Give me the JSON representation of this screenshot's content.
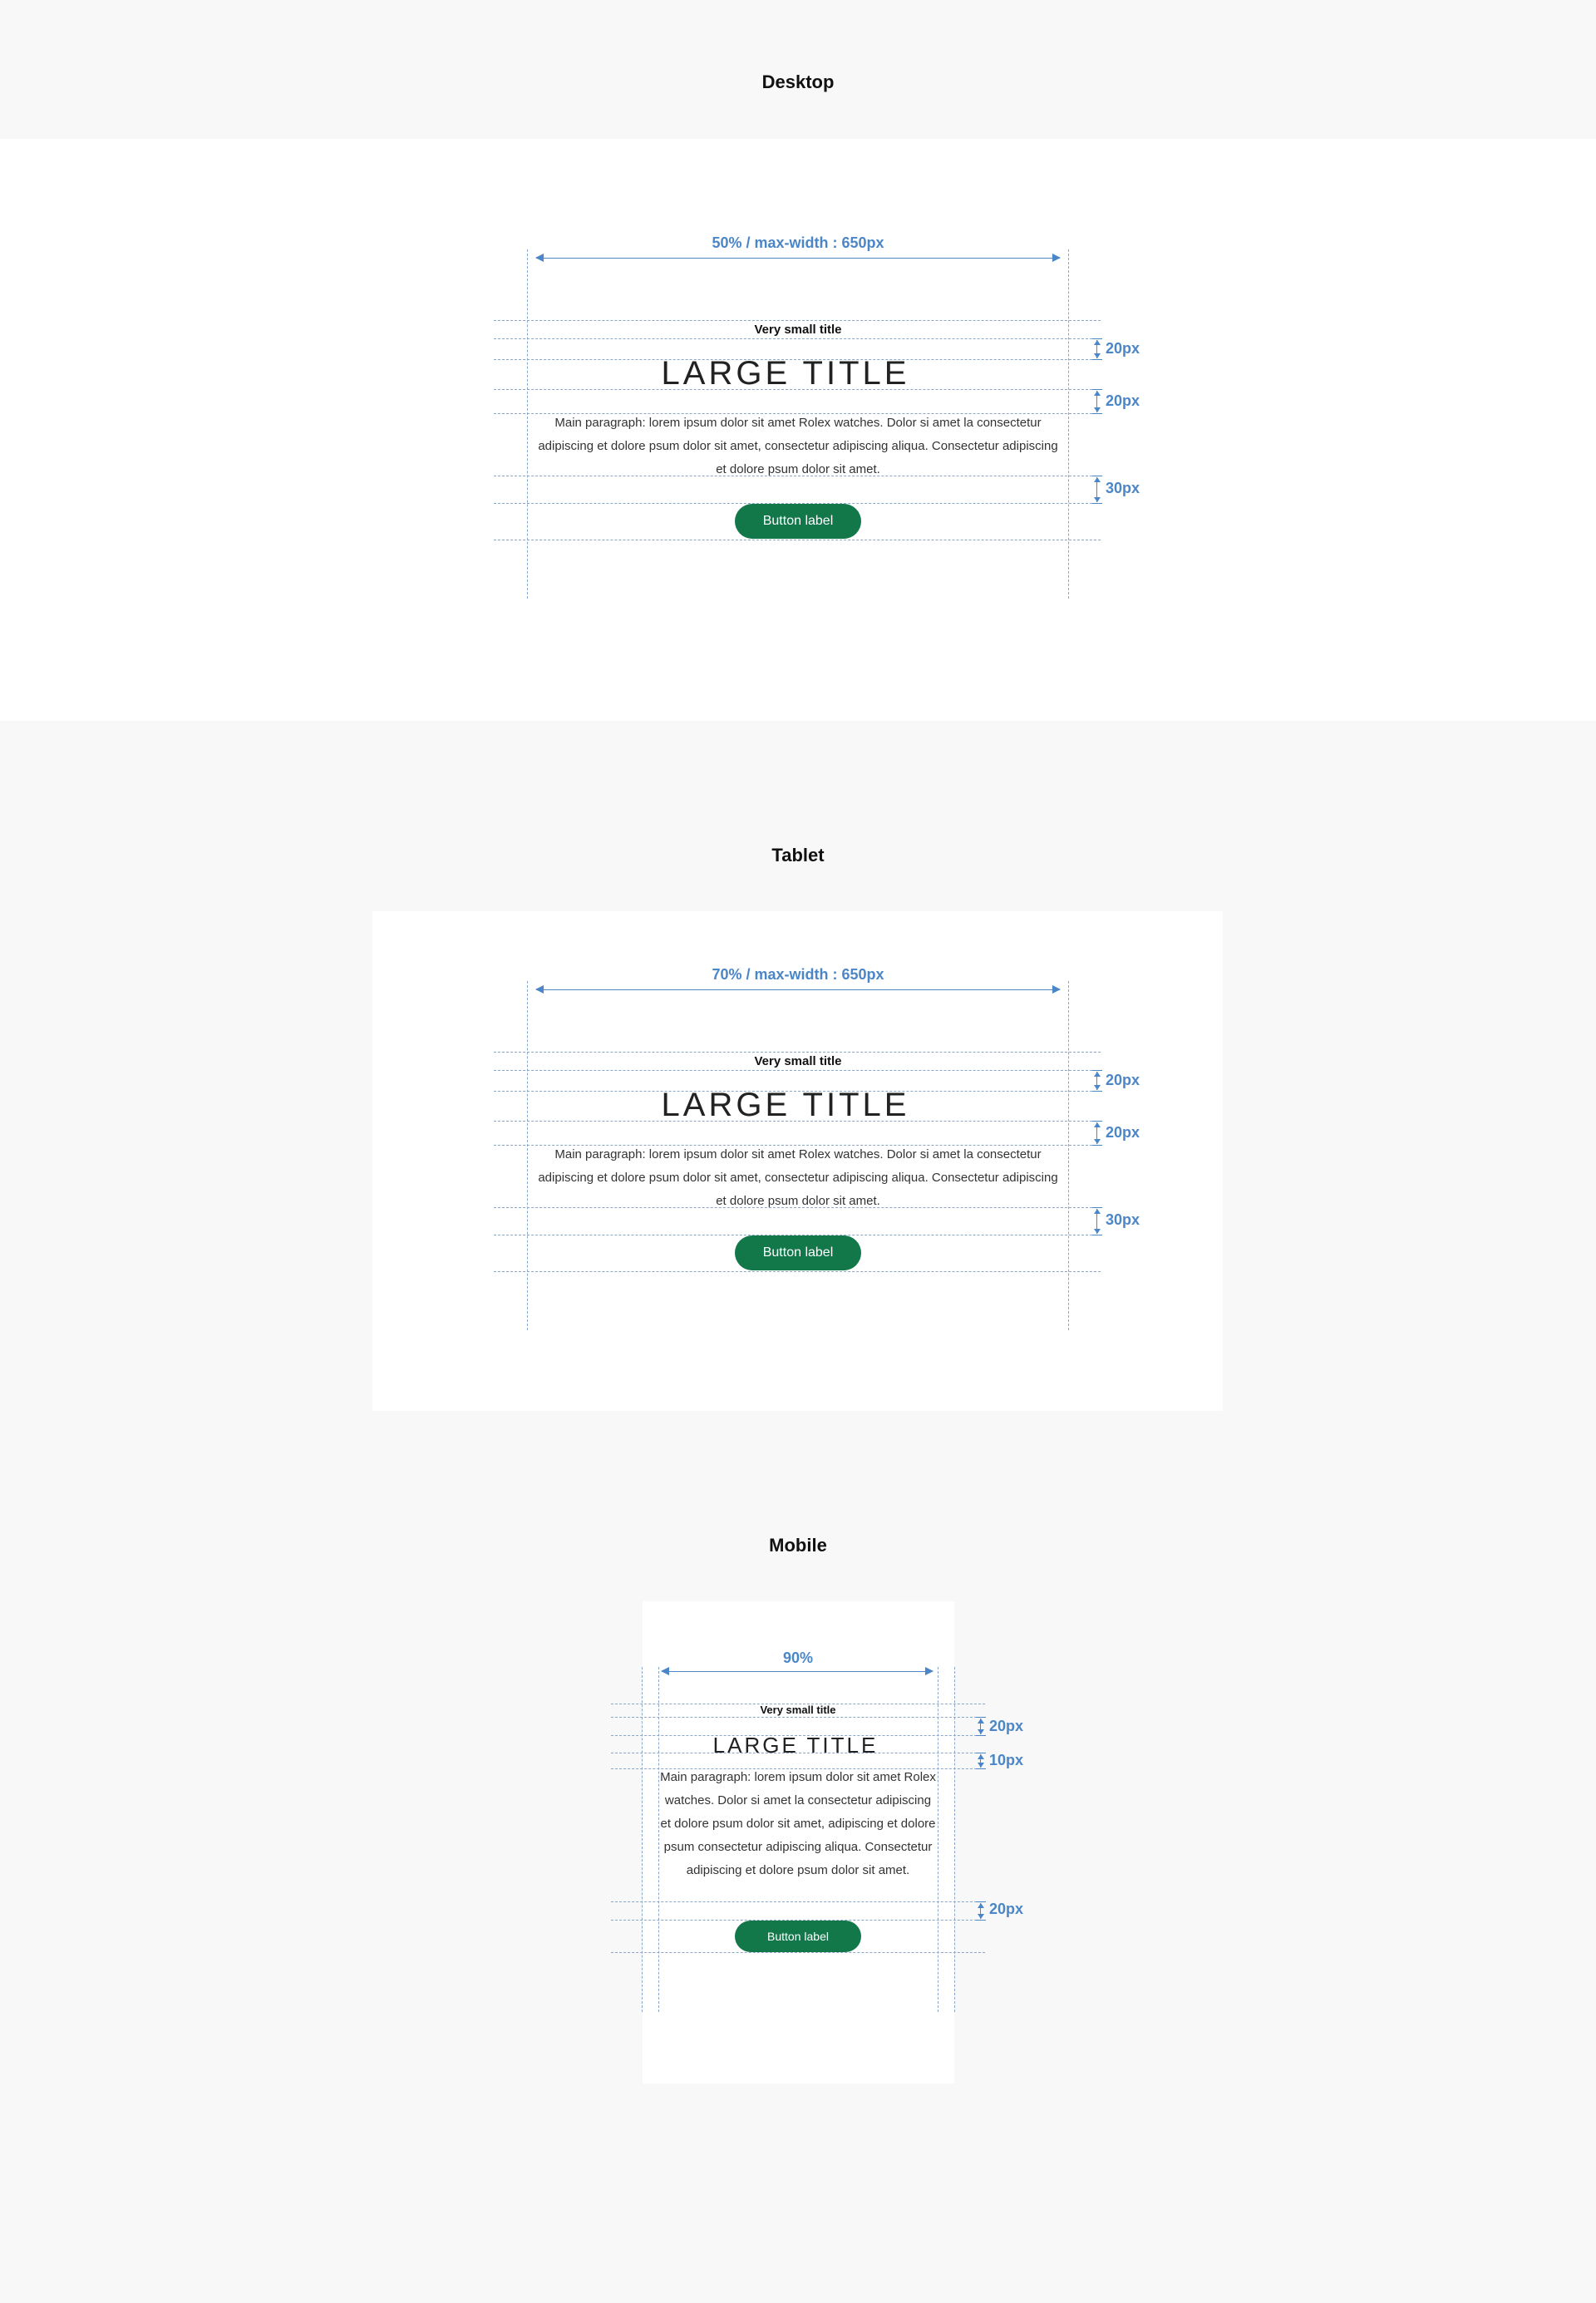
{
  "sections": {
    "desktop": {
      "title": "Desktop",
      "width_label": "50% / max-width : 650px",
      "spacing": [
        "20px",
        "20px",
        "30px"
      ],
      "small_title": "Very small title",
      "large_title": "LARGE TITLE",
      "paragraph": "Main paragraph: lorem ipsum dolor sit amet Rolex watches. Dolor si amet la consectetur adipiscing et dolore psum dolor sit amet, consectetur adipiscing  aliqua. Consectetur adipiscing et dolore psum dolor sit amet.",
      "button_label": "Button label"
    },
    "tablet": {
      "title": "Tablet",
      "width_label": "70% / max-width : 650px",
      "spacing": [
        "20px",
        "20px",
        "30px"
      ],
      "small_title": "Very small title",
      "large_title": "LARGE TITLE",
      "paragraph": "Main paragraph: lorem ipsum dolor sit amet Rolex watches. Dolor si amet la consectetur adipiscing et dolore psum dolor sit amet, consectetur adipiscing  aliqua. Consectetur adipiscing et dolore psum dolor sit amet.",
      "button_label": "Button label"
    },
    "mobile": {
      "title": "Mobile",
      "width_label": "90%",
      "spacing": [
        "20px",
        "10px",
        "20px"
      ],
      "small_title": "Very small title",
      "large_title": "LARGE TITLE",
      "paragraph": "Main paragraph: lorem ipsum dolor sit amet Rolex watches. Dolor si amet la consectetur adipiscing et dolore psum dolor sit amet, adipiscing et dolore psum consectetur adipiscing  aliqua. Consectetur adipiscing et dolore psum dolor sit amet.",
      "button_label": "Button label"
    }
  },
  "colors": {
    "page_background": "#f8f8f8",
    "panel_background": "#ffffff",
    "annotation_blue": "#4a86c8",
    "guide_dash": "#8aa6c8",
    "button_green": "#127749",
    "button_text": "#ffffff"
  }
}
